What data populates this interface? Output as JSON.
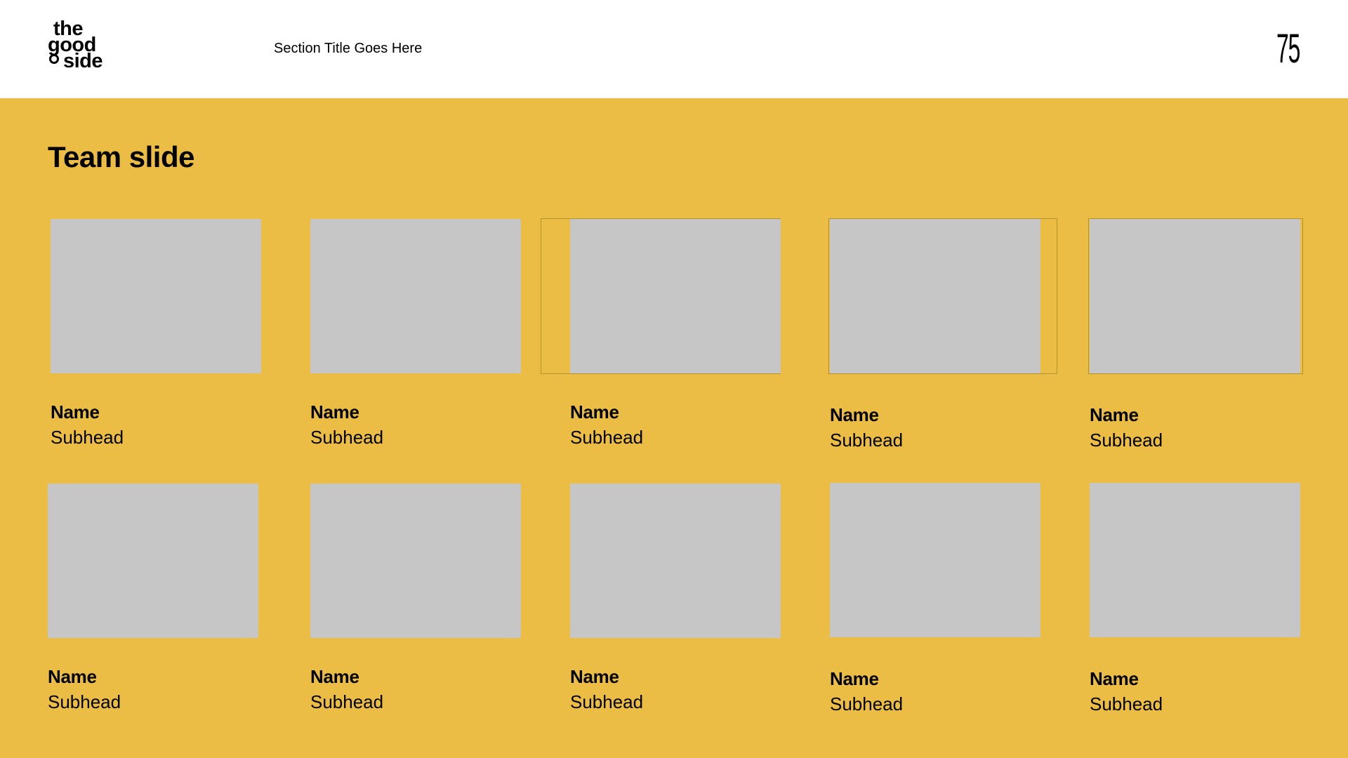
{
  "header": {
    "logo_lines": [
      "the",
      "good",
      "side"
    ],
    "section_title": "Section Title Goes Here",
    "page_number": "75"
  },
  "slide": {
    "title": "Team slide",
    "colors": {
      "band": "#ebbd44",
      "photo_placeholder": "#c6c6c6"
    }
  },
  "team": [
    {
      "name": "Name",
      "subhead": "Subhead"
    },
    {
      "name": "Name",
      "subhead": "Subhead"
    },
    {
      "name": "Name",
      "subhead": "Subhead"
    },
    {
      "name": "Name",
      "subhead": "Subhead"
    },
    {
      "name": "Name",
      "subhead": "Subhead"
    },
    {
      "name": "Name",
      "subhead": "Subhead"
    },
    {
      "name": "Name",
      "subhead": "Subhead"
    },
    {
      "name": "Name",
      "subhead": "Subhead"
    },
    {
      "name": "Name",
      "subhead": "Subhead"
    },
    {
      "name": "Name",
      "subhead": "Subhead"
    }
  ]
}
